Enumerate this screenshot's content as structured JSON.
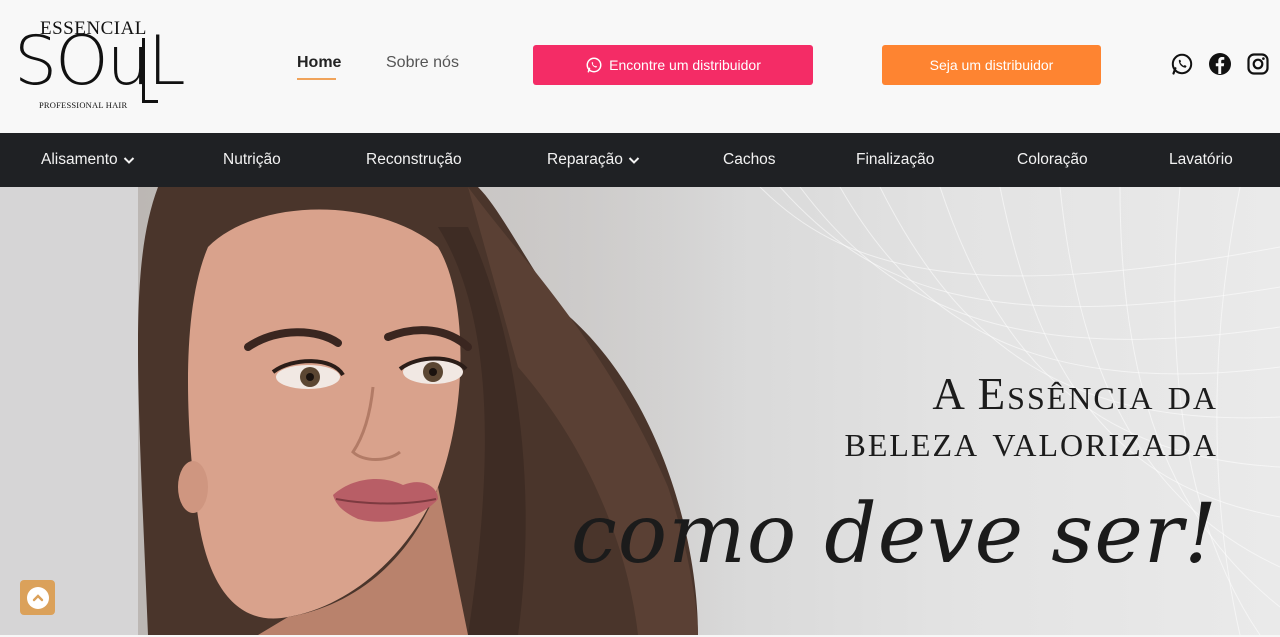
{
  "logo": {
    "top_text": "ESSENCIAL",
    "main_text": "SOuL",
    "sub_text": "PROFESSIONAL HAIR"
  },
  "nav": {
    "home": "Home",
    "about": "Sobre nós"
  },
  "buttons": {
    "find_distributor": "Encontre um distribuidor",
    "be_distributor": "Seja um distribuidor"
  },
  "social": {
    "whatsapp": "whatsapp-icon",
    "facebook": "facebook-icon",
    "instagram": "instagram-icon"
  },
  "categories": [
    {
      "label": "Alisamento",
      "dropdown": true
    },
    {
      "label": "Nutrição",
      "dropdown": false
    },
    {
      "label": "Reconstrução",
      "dropdown": false
    },
    {
      "label": "Reparação",
      "dropdown": true
    },
    {
      "label": "Cachos",
      "dropdown": false
    },
    {
      "label": "Finalização",
      "dropdown": false
    },
    {
      "label": "Coloração",
      "dropdown": false
    },
    {
      "label": "Lavatório",
      "dropdown": false
    }
  ],
  "hero": {
    "line1": "A Essência da",
    "line2": "beleza valorizada",
    "script": "como deve ser!"
  },
  "colors": {
    "pink_button": "#f42c66",
    "orange_button": "#fe8431",
    "category_bar": "#1f2124",
    "scroll_button": "#dba15a",
    "home_underline": "#f0a35a"
  }
}
